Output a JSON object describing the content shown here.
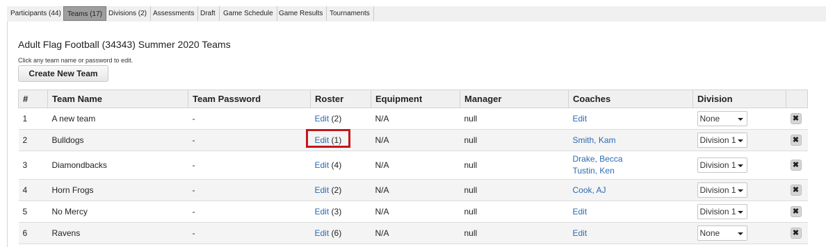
{
  "tabs": [
    {
      "label": "Participants (44)",
      "active": false
    },
    {
      "label": "Teams (17)",
      "active": true
    },
    {
      "label": "Divisions (2)",
      "active": false
    },
    {
      "label": "Assessments",
      "active": false
    },
    {
      "label": "Draft",
      "active": false
    },
    {
      "label": "Game Schedule",
      "active": false
    },
    {
      "label": "Game Results",
      "active": false
    },
    {
      "label": "Tournaments",
      "active": false
    }
  ],
  "page": {
    "title": "Adult Flag Football (34343) Summer 2020 Teams",
    "hint": "Click any team name or password to edit.",
    "create_button": "Create New Team"
  },
  "table": {
    "headers": [
      "#",
      "Team Name",
      "Team Password",
      "Roster",
      "Equipment",
      "Manager",
      "Coaches",
      "Division",
      ""
    ],
    "rows": [
      {
        "num": "1",
        "name": "A new team",
        "password": "-",
        "roster_link": "Edit",
        "roster_count": "(2)",
        "equipment": "N/A",
        "manager": "null",
        "coaches": [
          "Edit"
        ],
        "division": "None"
      },
      {
        "num": "2",
        "name": "Bulldogs",
        "password": "-",
        "roster_link": "Edit",
        "roster_count": "(1)",
        "equipment": "N/A",
        "manager": "null",
        "coaches": [
          "Smith, Kam"
        ],
        "division": "Division 1"
      },
      {
        "num": "3",
        "name": "Diamondbacks",
        "password": "-",
        "roster_link": "Edit",
        "roster_count": "(4)",
        "equipment": "N/A",
        "manager": "null",
        "coaches": [
          "Drake, Becca",
          "Tustin, Ken"
        ],
        "division": "Division 1"
      },
      {
        "num": "4",
        "name": "Horn Frogs",
        "password": "-",
        "roster_link": "Edit",
        "roster_count": "(2)",
        "equipment": "N/A",
        "manager": "null",
        "coaches": [
          "Cook, AJ"
        ],
        "division": "Division 1"
      },
      {
        "num": "5",
        "name": "No Mercy",
        "password": "-",
        "roster_link": "Edit",
        "roster_count": "(3)",
        "equipment": "N/A",
        "manager": "null",
        "coaches": [
          "Edit"
        ],
        "division": "Division 1"
      },
      {
        "num": "6",
        "name": "Ravens",
        "password": "-",
        "roster_link": "Edit",
        "roster_count": "(6)",
        "equipment": "N/A",
        "manager": "null",
        "coaches": [
          "Edit"
        ],
        "division": "None"
      }
    ],
    "delete_icon": "close-icon"
  },
  "colors": {
    "link": "#2a6ab4",
    "highlight": "#c4161c",
    "active_tab": "#9e9e9e"
  }
}
